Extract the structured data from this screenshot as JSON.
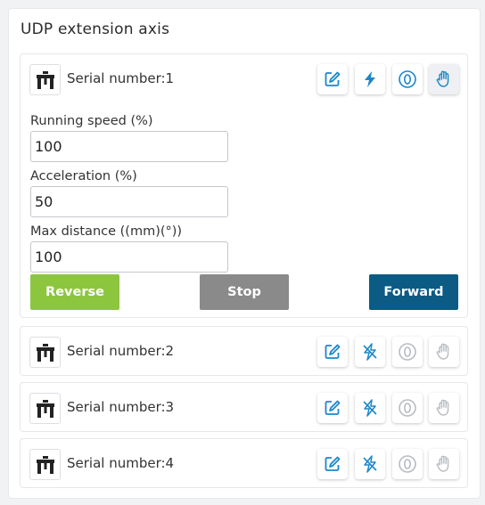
{
  "panel": {
    "title": "UDP extension axis"
  },
  "colors": {
    "primary": "#1b87c9",
    "reverse": "#8cc63f",
    "stop": "#8a8a8a",
    "forward": "#0b5b84",
    "disabled_icon": "#b8bcc2"
  },
  "axes": [
    {
      "label": "Serial number:1",
      "expanded": true,
      "toolbar": [
        "edit-icon",
        "power-icon",
        "zero-icon",
        "hand-icon"
      ],
      "fields": {
        "speed_label": "Running speed (%)",
        "speed_value": "100",
        "accel_label": "Acceleration (%)",
        "accel_value": "50",
        "distance_label": "Max distance ((mm)(°))",
        "distance_value": "100"
      },
      "buttons": {
        "reverse": "Reverse",
        "stop": "Stop",
        "forward": "Forward"
      }
    },
    {
      "label": "Serial number:2",
      "expanded": false
    },
    {
      "label": "Serial number:3",
      "expanded": false
    },
    {
      "label": "Serial number:4",
      "expanded": false
    }
  ]
}
